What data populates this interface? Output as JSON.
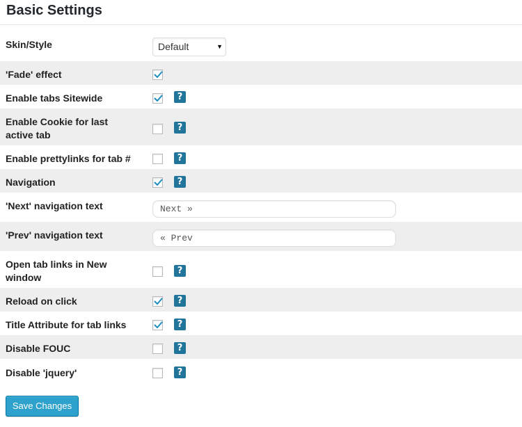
{
  "page": {
    "title": "Basic Settings"
  },
  "skin": {
    "label": "Skin/Style",
    "selected": "Default"
  },
  "fade": {
    "label": "'Fade' effect",
    "checked": true
  },
  "tabs_sitewide": {
    "label": "Enable tabs Sitewide",
    "checked": true
  },
  "cookie": {
    "label_line1": "Enable Cookie for last",
    "label_line2": "active tab",
    "checked": false
  },
  "prettylinks": {
    "label": "Enable prettylinks for tab #",
    "checked": false
  },
  "navigation": {
    "label": "Navigation",
    "checked": true
  },
  "next_text": {
    "label": "'Next' navigation text",
    "value": "Next »"
  },
  "prev_text": {
    "label": "'Prev' navigation text",
    "value": "« Prev"
  },
  "new_window": {
    "label_line1": "Open tab links in New",
    "label_line2": "window",
    "checked": false
  },
  "reload": {
    "label": "Reload on click",
    "checked": true
  },
  "title_attr": {
    "label": "Title Attribute for tab links",
    "checked": true
  },
  "fouc": {
    "label": "Disable FOUC",
    "checked": false
  },
  "jquery": {
    "label": "Disable 'jquery'",
    "checked": false
  },
  "help": {
    "symbol": "?"
  },
  "actions": {
    "save_label": "Save Changes"
  },
  "colors": {
    "accent": "#2ea2cc",
    "help_bg": "#21759b",
    "checkmark": "#1e8cbe",
    "row_alt": "#eeeeee"
  },
  "icons": {
    "select_arrow": "▼"
  }
}
